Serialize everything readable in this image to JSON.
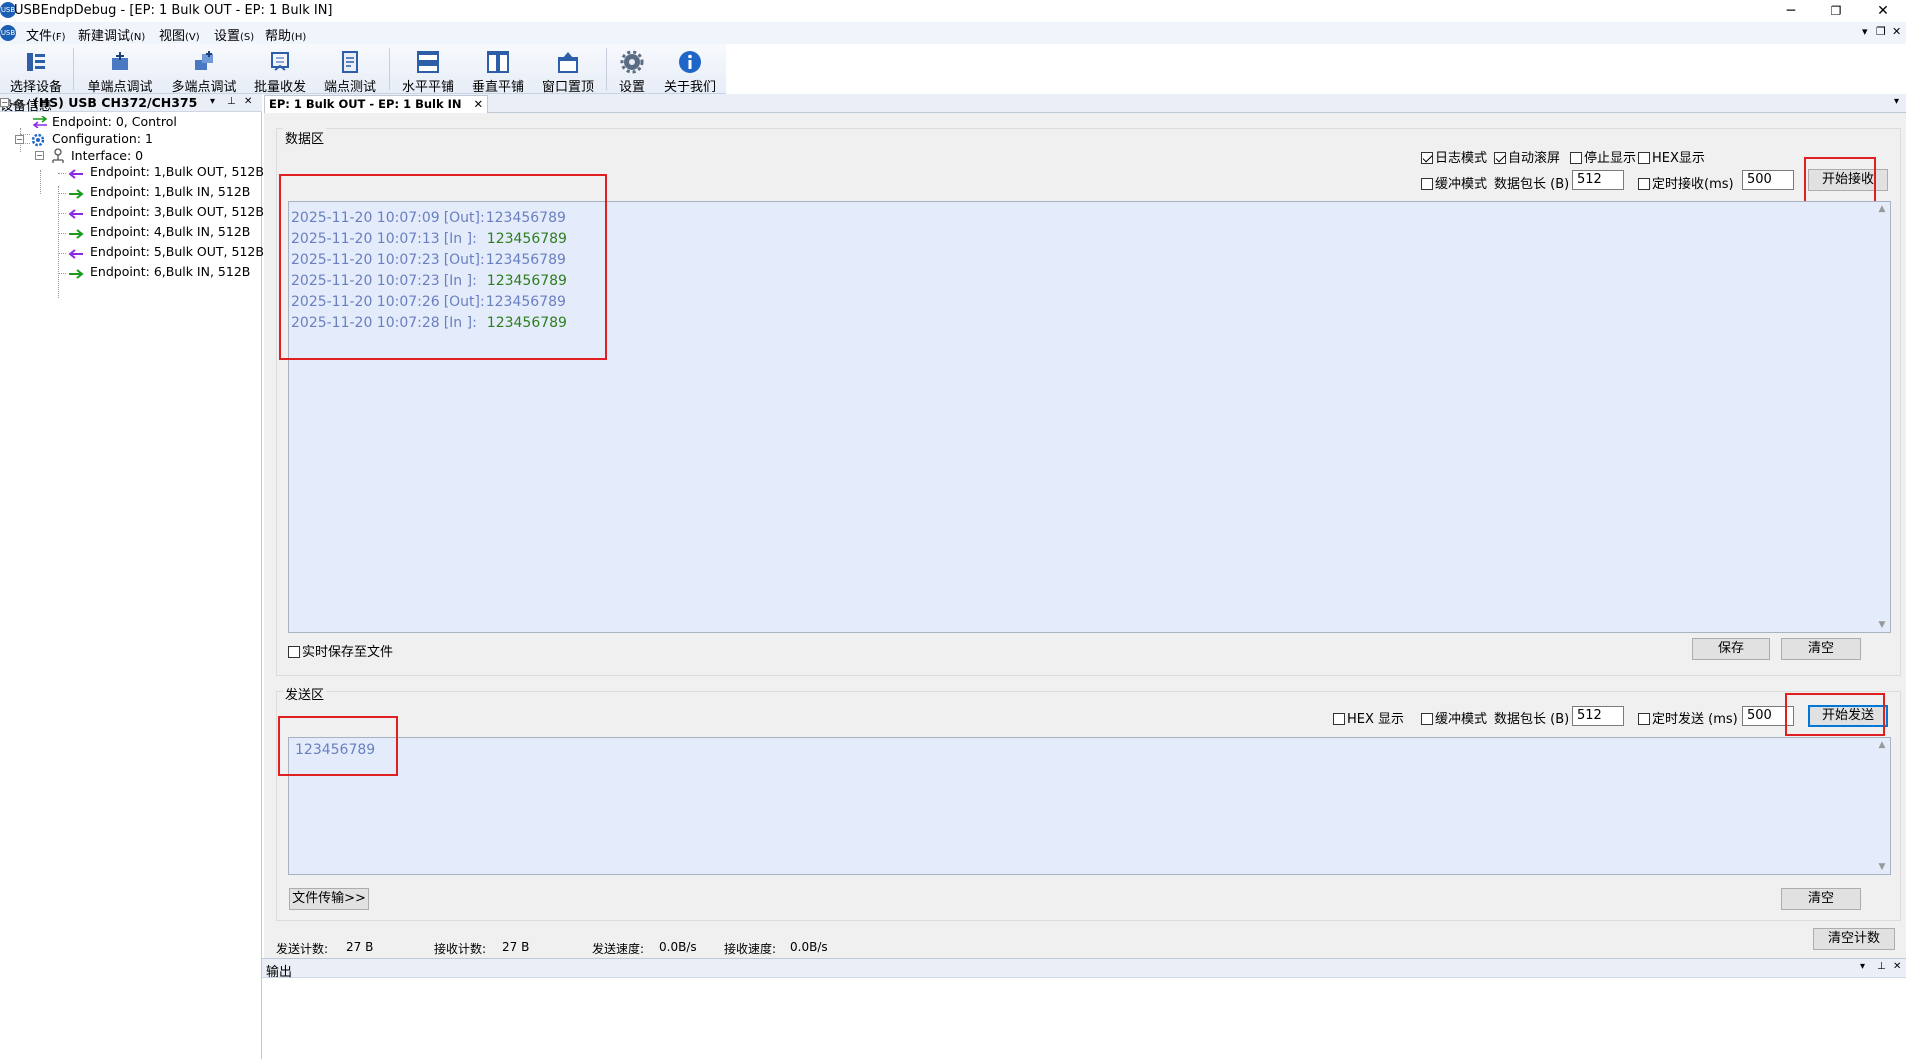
{
  "window": {
    "title": "USBEndpDebug - [EP: 1 Bulk OUT - EP: 1 Bulk IN]",
    "app_icon_text": "USB",
    "minimize": "─",
    "restore": "❐",
    "close": "✕"
  },
  "menu": {
    "items": [
      {
        "label": "文件",
        "key": "(F)"
      },
      {
        "label": "新建调试",
        "key": "(N)"
      },
      {
        "label": "视图",
        "key": "(V)"
      },
      {
        "label": "设置",
        "key": "(S)"
      },
      {
        "label": "帮助",
        "key": "(H)"
      }
    ],
    "mdi_min": "▾",
    "mdi_restore": "❐",
    "mdi_close": "✕"
  },
  "toolbar": {
    "buttons": [
      {
        "label": "选择设备",
        "icon": "device-select-icon"
      },
      {
        "label": "单端点调试",
        "icon": "single-endpoint-icon"
      },
      {
        "label": "多端点调试",
        "icon": "multi-endpoint-icon"
      },
      {
        "label": "批量收发",
        "icon": "batch-transfer-icon"
      },
      {
        "label": "端点测试",
        "icon": "endpoint-test-icon"
      },
      {
        "label": "水平平铺",
        "icon": "tile-horizontal-icon"
      },
      {
        "label": "垂直平铺",
        "icon": "tile-vertical-icon"
      },
      {
        "label": "窗口置顶",
        "icon": "window-top-icon"
      },
      {
        "label": "设置",
        "icon": "gear-icon"
      },
      {
        "label": "关于我们",
        "icon": "info-icon"
      }
    ]
  },
  "device_panel": {
    "title": "设备信息",
    "tree": {
      "device": "(HS) USB CH372/CH375",
      "endpoint0": "Endpoint: 0, Control",
      "configuration": "Configuration: 1",
      "interface": "Interface: 0",
      "endpoints": [
        {
          "label": "Endpoint: 1,Bulk OUT, 512B",
          "dir": "out"
        },
        {
          "label": "Endpoint: 1,Bulk IN, 512B",
          "dir": "in"
        },
        {
          "label": "Endpoint: 3,Bulk OUT, 512B",
          "dir": "out"
        },
        {
          "label": "Endpoint: 4,Bulk IN, 512B",
          "dir": "in"
        },
        {
          "label": "Endpoint: 5,Bulk OUT, 512B",
          "dir": "out"
        },
        {
          "label": "Endpoint: 6,Bulk IN, 512B",
          "dir": "in"
        }
      ]
    },
    "colors": {
      "out": "#8a2be2",
      "in": "#1a9a1a"
    }
  },
  "tab": {
    "label": "EP: 1 Bulk OUT - EP: 1 Bulk IN",
    "close": "✕"
  },
  "data_area": {
    "label": "数据区",
    "options": {
      "log_mode": {
        "label": "日志模式",
        "checked": true
      },
      "auto_scroll": {
        "label": "自动滚屏",
        "checked": true
      },
      "stop_display": {
        "label": "停止显示",
        "checked": false
      },
      "hex_display": {
        "label": "HEX显示",
        "checked": false
      },
      "buffer_mode": {
        "label": "缓冲模式",
        "checked": false
      },
      "packet_len_label": "数据包长 (B)",
      "packet_len_value": "512",
      "timed_recv": {
        "label": "定时接收(ms)",
        "checked": false
      },
      "timed_recv_value": "500"
    },
    "start_button": "开始接收",
    "log": [
      {
        "time": "2025-11-20 10:07:09",
        "dir": "[Out]:",
        "data": "123456789",
        "type": "out"
      },
      {
        "time": "2025-11-20 10:07:13",
        "dir": "[In ]:",
        "data": "123456789",
        "type": "in"
      },
      {
        "time": "2025-11-20 10:07:23",
        "dir": "[Out]:",
        "data": "123456789",
        "type": "out"
      },
      {
        "time": "2025-11-20 10:07:23",
        "dir": "[In ]:",
        "data": "123456789",
        "type": "in"
      },
      {
        "time": "2025-11-20 10:07:26",
        "dir": "[Out]:",
        "data": "123456789",
        "type": "out"
      },
      {
        "time": "2025-11-20 10:07:28",
        "dir": "[In ]:",
        "data": "123456789",
        "type": "in"
      }
    ],
    "colors": {
      "prefix": "#6a7fc0",
      "out": "#6a7fc0",
      "in": "#2e7d1e"
    },
    "realtime_save": {
      "label": "实时保存至文件",
      "checked": false
    },
    "save_button": "保存",
    "clear_button": "清空"
  },
  "send_area": {
    "label": "发送区",
    "hex_display": {
      "label": "HEX 显示",
      "checked": false
    },
    "buffer_mode": {
      "label": "缓冲模式",
      "checked": false
    },
    "packet_len_label": "数据包长 (B)",
    "packet_len_value": "512",
    "timed_send": {
      "label": "定时发送 (ms)",
      "checked": false
    },
    "timed_send_value": "500",
    "start_button": "开始发送",
    "content": "123456789",
    "file_transfer_button": "文件传输>>",
    "clear_button": "清空"
  },
  "status": {
    "send_count_label": "发送计数:",
    "send_count": "27 B",
    "recv_count_label": "接收计数:",
    "recv_count": "27 B",
    "send_speed_label": "发送速度:",
    "send_speed": "0.0B/s",
    "recv_speed_label": "接收速度:",
    "recv_speed": "0.0B/s",
    "clear_count_button": "清空计数"
  },
  "output_panel": {
    "title": "输出"
  },
  "panel_controls": {
    "dropdown": "▾",
    "pin": "⊥",
    "close": "✕"
  },
  "highlight_color": "#e02020"
}
